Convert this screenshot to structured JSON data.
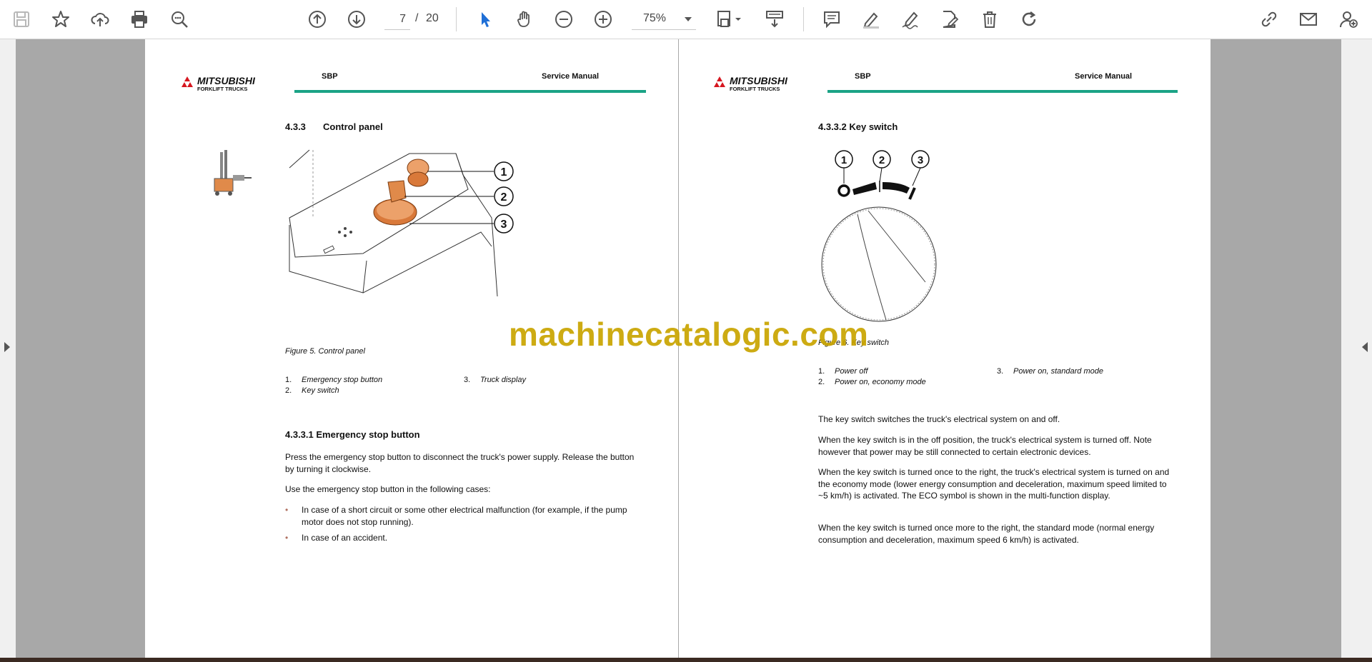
{
  "toolbar": {
    "page_current": "7",
    "page_separator": "/",
    "page_total": "20",
    "zoom": "75%",
    "icons": [
      "save-icon",
      "star-icon",
      "cloud-upload-icon",
      "print-icon",
      "zoom-search-icon",
      "page-up-icon",
      "page-down-icon",
      "select-cursor-icon",
      "hand-icon",
      "zoom-out-icon",
      "zoom-in-icon",
      "fit-page-icon",
      "scroll-mode-icon",
      "comment-icon",
      "highlight-pen-icon",
      "draw-signature-icon",
      "edit-pdf-icon",
      "delete-icon",
      "rotate-icon",
      "share-link-icon",
      "email-icon",
      "add-user-icon"
    ]
  },
  "left_page": {
    "header": {
      "logo_text": "MITSUBISHI",
      "logo_sub": "FORKLIFT TRUCKS",
      "model": "SBP",
      "manual": "Service Manual"
    },
    "section_number": "4.3.3",
    "section_title": "Control panel",
    "figure_callouts": [
      "1",
      "2",
      "3"
    ],
    "figure_caption": "Figure 5. Control panel",
    "legend": [
      {
        "num": "1.",
        "text": "Emergency stop button"
      },
      {
        "num": "2.",
        "text": "Key switch"
      },
      {
        "num": "3.",
        "text": "Truck display"
      }
    ],
    "subsection": "4.3.3.1   Emergency stop button",
    "para1": "Press the emergency stop button to disconnect the truck's power supply. Release the button by turning it clockwise.",
    "para2": "Use the emergency stop button in the following cases:",
    "bullets": [
      "In case of a short circuit or some other electrical malfunction (for example, if the pump motor does not stop running).",
      "In case of an accident."
    ]
  },
  "right_page": {
    "header": {
      "logo_text": "MITSUBISHI",
      "logo_sub": "FORKLIFT TRUCKS",
      "model": "SBP",
      "manual": "Service Manual"
    },
    "section_title": "4.3.3.2   Key switch",
    "figure_callouts": [
      "1",
      "2",
      "3"
    ],
    "figure_caption": "Figure 6. Key switch",
    "legend": [
      {
        "num": "1.",
        "text": "Power off"
      },
      {
        "num": "2.",
        "text": "Power on, economy mode"
      },
      {
        "num": "3.",
        "text": "Power on, standard mode"
      }
    ],
    "para1": "The key switch switches the truck's electrical system on and off.",
    "para2": "When the key switch is in the off position, the truck's electrical system is turned off. Note however that power may be still connected to certain electronic devices.",
    "para3": "When the key switch is turned once to the right, the truck's electrical system is turned on and the economy mode (lower energy consumption and deceleration, maximum speed limited to ~5 km/h) is activated. The ECO symbol is shown in the multi-function display.",
    "para4": "When the key switch is turned once more to the right, the standard mode (normal energy consumption and deceleration, maximum speed 6 km/h) is activated."
  },
  "watermark": "machinecatalogic.com",
  "colors": {
    "accent_line": "#1aa386",
    "logo_red": "#d6161f",
    "watermark": "#c9a400",
    "callout_orange": "#e08a4a"
  }
}
